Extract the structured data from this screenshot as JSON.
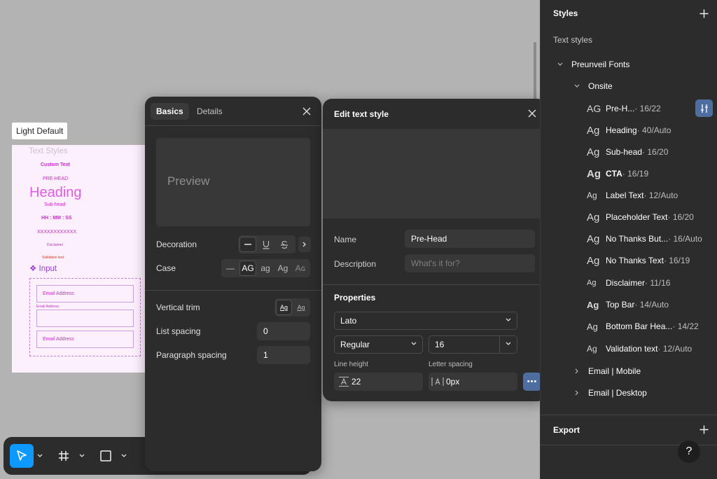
{
  "canvas": {
    "frame_label": "Light Default",
    "artboard": {
      "title": "Text Styles",
      "custom_text": "Custom Text",
      "pre_head": "PRE-HEAD",
      "heading": "Heading",
      "sub_head": "Sub-head",
      "time": "HH : MM : SS",
      "xxx": "XXXXXXXXXXXX",
      "disclaimer": "Disclaimer",
      "validation": "Validation text",
      "input_label": "❖ Input",
      "field1": "Email Address",
      "field_label": "Email Address",
      "field3": "Email Address"
    }
  },
  "toolbar": {
    "tools": [
      {
        "name": "move-tool",
        "icon": "cursor-icon",
        "active": true
      },
      {
        "name": "frame-tool",
        "icon": "hash-icon",
        "active": false
      },
      {
        "name": "shape-tool",
        "icon": "rectangle-icon",
        "active": false
      }
    ]
  },
  "basics_panel": {
    "tabs": [
      "Basics",
      "Details"
    ],
    "preview": "Preview",
    "decoration_label": "Decoration",
    "case_label": "Case",
    "case_options": [
      "—",
      "AG",
      "ag",
      "Ag",
      "Aɢ"
    ],
    "vertical_trim_label": "Vertical trim",
    "vertical_trim_options": [
      "Ag",
      "Ag"
    ],
    "list_spacing_label": "List spacing",
    "list_spacing_value": "0",
    "paragraph_spacing_label": "Paragraph spacing",
    "paragraph_spacing_value": "1"
  },
  "edit_panel": {
    "title": "Edit text style",
    "name_label": "Name",
    "name_value": "Pre-Head",
    "description_label": "Description",
    "description_placeholder": "What's it for?",
    "properties_title": "Properties",
    "font_family": "Lato",
    "font_weight": "Regular",
    "font_size": "16",
    "line_height_label": "Line height",
    "line_height_value": "22",
    "letter_spacing_label": "Letter spacing",
    "letter_spacing_value": "0px",
    "more_label": "•••"
  },
  "sidebar": {
    "title": "Styles",
    "section": "Text styles",
    "group": "Preunveil Fonts",
    "subgroup": "Onsite",
    "styles": [
      {
        "ag": "AG",
        "name": "Pre-H...",
        "meta": " · 16/22"
      },
      {
        "ag": "Ag",
        "name": "Heading",
        "meta": " · 40/Auto"
      },
      {
        "ag": "Ag",
        "name": "Sub-head",
        "meta": " · 16/20"
      },
      {
        "ag": "Ag",
        "name": "CTA",
        "meta": " · 16/19"
      },
      {
        "ag": "Ag",
        "name": "Label Text",
        "meta": " · 12/Auto"
      },
      {
        "ag": "Ag",
        "name": "Placeholder Text",
        "meta": " · 16/20"
      },
      {
        "ag": "Ag",
        "name": "No Thanks But...",
        "meta": " · 16/Auto"
      },
      {
        "ag": "Ag",
        "name": "No Thanks Text",
        "meta": " · 16/19"
      },
      {
        "ag": "Ag",
        "name": "Disclaimer",
        "meta": " · 11/16"
      },
      {
        "ag": "Ag",
        "name": "Top Bar",
        "meta": " · 14/Auto"
      },
      {
        "ag": "Ag",
        "name": "Bottom Bar Hea...",
        "meta": " · 14/22"
      },
      {
        "ag": "Ag",
        "name": "Validation text",
        "meta": " · 12/Auto"
      }
    ],
    "collapsed_groups": [
      "Email | Mobile",
      "Email | Desktop"
    ],
    "export_label": "Export",
    "help_label": "?"
  },
  "colors": {
    "accent": "#0d99ff",
    "panel_bg": "#2c2c2c",
    "canvas_bg": "#b3b3b3",
    "selected_btn": "#4f6ea0"
  }
}
